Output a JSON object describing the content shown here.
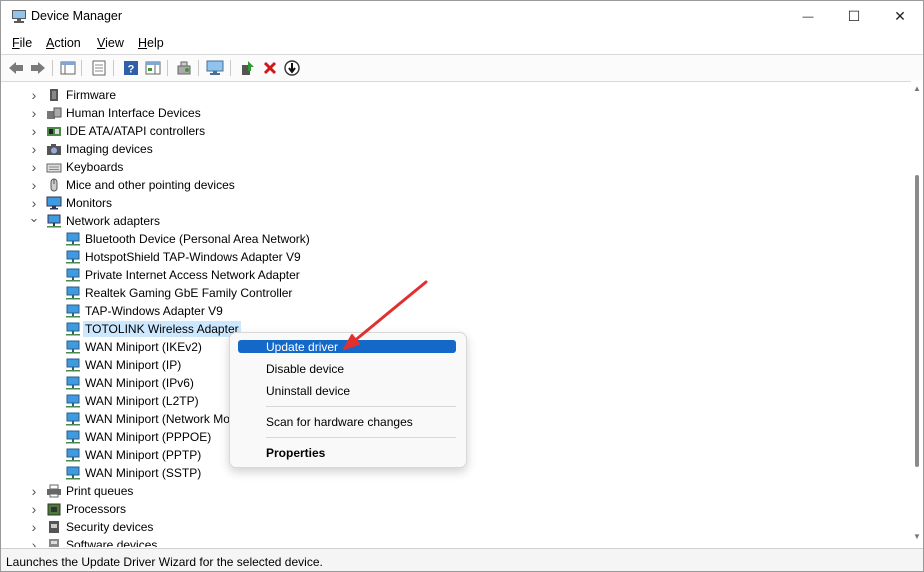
{
  "window": {
    "title": "Device Manager",
    "minimize_glyph": "—",
    "maximize_glyph": "☐",
    "close_glyph": "✕"
  },
  "menu": [
    {
      "label": "File",
      "key": "F",
      "rest": "ile"
    },
    {
      "label": "Action",
      "key": "A",
      "rest": "ction"
    },
    {
      "label": "View",
      "key": "V",
      "rest": "iew"
    },
    {
      "label": "Help",
      "key": "H",
      "rest": "elp"
    }
  ],
  "toolbar": {
    "icons": [
      "back-arrow-icon",
      "forward-arrow-icon",
      "console-tree-icon",
      "properties-icon",
      "help-icon",
      "action-pane-icon",
      "scan-hardware-icon",
      "monitor-icon",
      "update-driver-icon",
      "uninstall-icon",
      "disable-icon"
    ]
  },
  "tree": {
    "categories_above": [
      {
        "label": "Firmware",
        "icon": "firmware-icon"
      },
      {
        "label": "Human Interface Devices",
        "icon": "hid-icon"
      },
      {
        "label": "IDE ATA/ATAPI controllers",
        "icon": "ide-icon"
      },
      {
        "label": "Imaging devices",
        "icon": "camera-icon"
      },
      {
        "label": "Keyboards",
        "icon": "keyboard-icon"
      },
      {
        "label": "Mice and other pointing devices",
        "icon": "mouse-icon"
      },
      {
        "label": "Monitors",
        "icon": "monitor-icon"
      }
    ],
    "expanded_category": {
      "label": "Network adapters",
      "icon": "network-icon"
    },
    "network_adapters": [
      "Bluetooth Device (Personal Area Network)",
      "HotspotShield TAP-Windows Adapter V9",
      "Private Internet Access Network Adapter",
      "Realtek Gaming GbE Family Controller",
      "TAP-Windows Adapter V9",
      "TOTOLINK Wireless Adapter",
      "WAN Miniport (IKEv2)",
      "WAN Miniport (IP)",
      "WAN Miniport (IPv6)",
      "WAN Miniport (L2TP)",
      "WAN Miniport (Network Monitor)",
      "WAN Miniport (PPPOE)",
      "WAN Miniport (PPTP)",
      "WAN Miniport (SSTP)"
    ],
    "selected_adapter": "TOTOLINK Wireless Adapter",
    "categories_below": [
      {
        "label": "Print queues",
        "icon": "printer-icon"
      },
      {
        "label": "Processors",
        "icon": "processor-icon"
      },
      {
        "label": "Security devices",
        "icon": "security-icon"
      },
      {
        "label": "Software devices",
        "icon": "software-icon"
      }
    ]
  },
  "context_menu": {
    "items": [
      {
        "label": "Update driver",
        "highlighted": true
      },
      {
        "label": "Disable device",
        "highlighted": false
      },
      {
        "label": "Uninstall device",
        "highlighted": false
      },
      {
        "label": "Scan for hardware changes",
        "highlighted": false
      },
      {
        "label": "Properties",
        "highlighted": false,
        "bold": true
      }
    ]
  },
  "status": {
    "text": "Launches the Update Driver Wizard for the selected device."
  },
  "colors": {
    "highlight": "#1468c8",
    "selection": "#cce8ff",
    "annotation_arrow": "#e03030"
  }
}
